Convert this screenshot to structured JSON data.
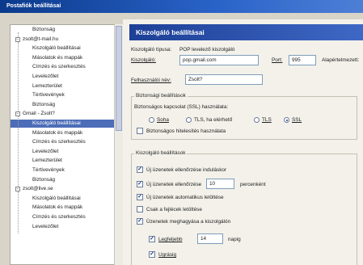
{
  "window": {
    "title": "Postafiók beállításai"
  },
  "tree": {
    "rows": [
      {
        "label": "Biztonság",
        "indent": 2,
        "selected": false
      },
      {
        "label": "zsolt@t-mail.hu",
        "indent": 1,
        "selected": false,
        "expander": "−"
      },
      {
        "label": "Kiszolgáló beállításai",
        "indent": 2,
        "selected": false
      },
      {
        "label": "Másolatok és mappák",
        "indent": 2,
        "selected": false
      },
      {
        "label": "Címzés és szerkesztés",
        "indent": 2,
        "selected": false
      },
      {
        "label": "Levelezőlet",
        "indent": 2,
        "selected": false
      },
      {
        "label": "Lemezterület",
        "indent": 2,
        "selected": false
      },
      {
        "label": "Tértivevények",
        "indent": 2,
        "selected": false
      },
      {
        "label": "Biztonság",
        "indent": 2,
        "selected": false
      },
      {
        "label": "Gmail - Zsolt?",
        "indent": 1,
        "selected": false,
        "expander": "−"
      },
      {
        "label": "Kiszolgáló beállításai",
        "indent": 2,
        "selected": true
      },
      {
        "label": "Másolatok és mappák",
        "indent": 2,
        "selected": false
      },
      {
        "label": "Címzés és szerkesztés",
        "indent": 2,
        "selected": false
      },
      {
        "label": "Levelezőlet",
        "indent": 2,
        "selected": false
      },
      {
        "label": "Lemezterület",
        "indent": 2,
        "selected": false
      },
      {
        "label": "Tértivevények",
        "indent": 2,
        "selected": false
      },
      {
        "label": "Biztonság",
        "indent": 2,
        "selected": false
      },
      {
        "label": "zsolt@live.se",
        "indent": 1,
        "selected": false,
        "expander": "−"
      },
      {
        "label": "Kiszolgáló beállításai",
        "indent": 2,
        "selected": false
      },
      {
        "label": "Másolatok és mappák",
        "indent": 2,
        "selected": false
      },
      {
        "label": "Címzés és szerkesztés",
        "indent": 2,
        "selected": false
      },
      {
        "label": "Levelezőlet",
        "indent": 2,
        "selected": false
      }
    ]
  },
  "pane": {
    "header": "Kiszolgáló beállításai",
    "server_type_label": "Kiszolgáló típusa:",
    "server_type_value": "POP levelező kiszolgáló",
    "server_label": "Kiszolgáló:",
    "server_value": "pop.gmail.com",
    "port_label": "Port:",
    "port_value": "995",
    "default_label": "Alapértelmezett:",
    "username_label": "Felhasználói név:",
    "username_value": "Zsolt?",
    "security": {
      "title": "Biztonsági beállítások",
      "connection_label": "Biztonságos kapcsolat (SSL) használata:",
      "options": [
        {
          "label": "Soha",
          "selected": false
        },
        {
          "label": "TLS, ha elérhető",
          "selected": false
        },
        {
          "label": "TLS",
          "selected": false
        },
        {
          "label": "SSL",
          "selected": true
        }
      ],
      "secure_auth_label": "Biztonságos hitelesítés használata"
    },
    "server_settings": {
      "title": "Kiszolgáló beállítások",
      "check_startup_label": "Új üzenetek ellenőrzése induláskor",
      "check_every_label": "Új üzenetek ellenőrzése",
      "check_every_value": "10",
      "minutes_label": "percenként",
      "auto_download_label": "Új üzenetek automatikus letöltése",
      "headers_only_label": "Csak a fejlécek letöltése",
      "leave_on_server_label": "Üzenetek meghagyása a kiszolgálón",
      "max_days_label": "Legfeljebb",
      "max_days_value": "14",
      "days_label": "napig",
      "until_delete_label": "Ugrásig"
    },
    "checks": {
      "secure_auth": false,
      "check_startup": true,
      "check_every": true,
      "auto_download": true,
      "headers_only": false,
      "leave_on_server": true,
      "max_days": true,
      "until_delete": true
    }
  }
}
